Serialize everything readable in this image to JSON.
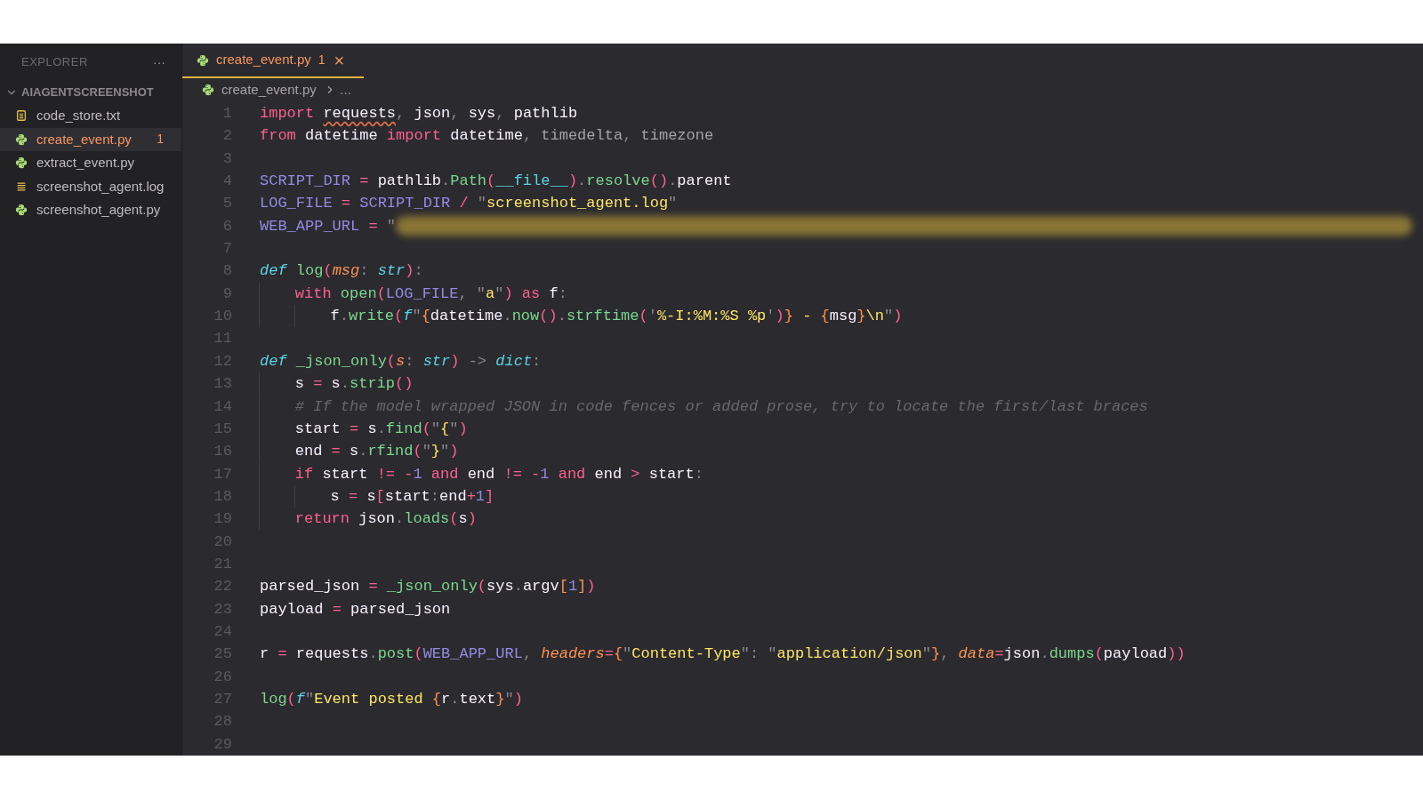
{
  "sidebar": {
    "title": "EXPLORER",
    "more": "···",
    "folder": {
      "name": "AIAGENTSCREENSHOT",
      "expanded": true
    },
    "files": [
      {
        "name": "code_store.txt",
        "kind": "text",
        "selected": false
      },
      {
        "name": "create_event.py",
        "kind": "python",
        "selected": true,
        "problems": "1"
      },
      {
        "name": "extract_event.py",
        "kind": "python",
        "selected": false
      },
      {
        "name": "screenshot_agent.log",
        "kind": "log",
        "selected": false
      },
      {
        "name": "screenshot_agent.py",
        "kind": "python",
        "selected": false
      }
    ]
  },
  "tab": {
    "name": "create_event.py",
    "kind": "python",
    "problems": "1",
    "close": "×",
    "selected": true
  },
  "breadcrumb": {
    "file": "create_event.py",
    "kind": "python",
    "rest": "…"
  },
  "lines": [
    {
      "number": "1",
      "tokens": [
        {
          "kind": "kw",
          "text": "import "
        },
        {
          "kind": "plain",
          "text": "requests",
          "warning": true
        },
        {
          "kind": "punct",
          "text": ", "
        },
        {
          "kind": "plain",
          "text": "json"
        },
        {
          "kind": "punct",
          "text": ", "
        },
        {
          "kind": "plain",
          "text": "sys"
        },
        {
          "kind": "punct",
          "text": ", "
        },
        {
          "kind": "plain",
          "text": "pathlib"
        }
      ]
    },
    {
      "number": "2",
      "tokens": [
        {
          "kind": "kw",
          "text": "from "
        },
        {
          "kind": "plain",
          "text": "datetime "
        },
        {
          "kind": "kw",
          "text": "import "
        },
        {
          "kind": "plain",
          "text": "datetime"
        },
        {
          "kind": "punct",
          "text": ", "
        },
        {
          "kind": "dim",
          "text": "timedelta"
        },
        {
          "kind": "punct",
          "text": ", "
        },
        {
          "kind": "dim",
          "text": "timezone"
        }
      ]
    },
    {
      "number": "3"
    },
    {
      "number": "4",
      "tokens": [
        {
          "kind": "var",
          "text": "SCRIPT_DIR "
        },
        {
          "kind": "op",
          "text": "= "
        },
        {
          "kind": "plain",
          "text": "pathlib"
        },
        {
          "kind": "punct",
          "text": "."
        },
        {
          "kind": "fn",
          "text": "Path"
        },
        {
          "kind": "paren",
          "text": "("
        },
        {
          "kind": "builtin",
          "text": "__file__"
        },
        {
          "kind": "paren",
          "text": ")"
        },
        {
          "kind": "punct",
          "text": "."
        },
        {
          "kind": "fn",
          "text": "resolve"
        },
        {
          "kind": "paren",
          "text": "()"
        },
        {
          "kind": "punct",
          "text": "."
        },
        {
          "kind": "plain",
          "text": "parent"
        }
      ]
    },
    {
      "number": "5",
      "tokens": [
        {
          "kind": "var",
          "text": "LOG_FILE "
        },
        {
          "kind": "op",
          "text": "= "
        },
        {
          "kind": "var",
          "text": "SCRIPT_DIR "
        },
        {
          "kind": "op",
          "text": "/ "
        },
        {
          "kind": "punct",
          "text": "\""
        },
        {
          "kind": "str",
          "text": "screenshot_agent.log"
        },
        {
          "kind": "punct",
          "text": "\""
        }
      ]
    },
    {
      "number": "6",
      "redacted": true,
      "tokens": [
        {
          "kind": "var",
          "text": "WEB_APP_URL "
        },
        {
          "kind": "op",
          "text": "= "
        },
        {
          "kind": "punct",
          "text": "\""
        }
      ]
    },
    {
      "number": "7"
    },
    {
      "number": "8",
      "tokens": [
        {
          "kind": "storage",
          "text": "def "
        },
        {
          "kind": "fn",
          "text": "log"
        },
        {
          "kind": "paren",
          "text": "("
        },
        {
          "kind": "param",
          "text": "msg"
        },
        {
          "kind": "punct",
          "text": ": "
        },
        {
          "kind": "type",
          "text": "str"
        },
        {
          "kind": "paren",
          "text": ")"
        },
        {
          "kind": "punct",
          "text": ":"
        }
      ]
    },
    {
      "number": "9",
      "tokens": [
        {
          "kind": "indent"
        },
        {
          "kind": "kw",
          "text": "with "
        },
        {
          "kind": "fn",
          "text": "open"
        },
        {
          "kind": "paren",
          "text": "("
        },
        {
          "kind": "var",
          "text": "LOG_FILE"
        },
        {
          "kind": "punct",
          "text": ", \""
        },
        {
          "kind": "str",
          "text": "a"
        },
        {
          "kind": "punct",
          "text": "\""
        },
        {
          "kind": "paren",
          "text": ")"
        },
        {
          "kind": "kw",
          "text": " as "
        },
        {
          "kind": "plain",
          "text": "f"
        },
        {
          "kind": "punct",
          "text": ":"
        }
      ]
    },
    {
      "number": "10",
      "tokens": [
        {
          "kind": "indent"
        },
        {
          "kind": "indent"
        },
        {
          "kind": "plain",
          "text": "f"
        },
        {
          "kind": "punct",
          "text": "."
        },
        {
          "kind": "fn",
          "text": "write"
        },
        {
          "kind": "paren",
          "text": "("
        },
        {
          "kind": "storage",
          "text": "f"
        },
        {
          "kind": "punct",
          "text": "\""
        },
        {
          "kind": "bracket",
          "text": "{"
        },
        {
          "kind": "plain",
          "text": "datetime"
        },
        {
          "kind": "punct",
          "text": "."
        },
        {
          "kind": "fn",
          "text": "now"
        },
        {
          "kind": "paren",
          "text": "()"
        },
        {
          "kind": "punct",
          "text": "."
        },
        {
          "kind": "fn",
          "text": "strftime"
        },
        {
          "kind": "paren",
          "text": "("
        },
        {
          "kind": "punct",
          "text": "'"
        },
        {
          "kind": "str",
          "text": "%-I:%M:%S %p"
        },
        {
          "kind": "punct",
          "text": "'"
        },
        {
          "kind": "paren",
          "text": ")"
        },
        {
          "kind": "bracket",
          "text": "}"
        },
        {
          "kind": "str",
          "text": " - "
        },
        {
          "kind": "bracket",
          "text": "{"
        },
        {
          "kind": "plain",
          "text": "msg"
        },
        {
          "kind": "bracket",
          "text": "}"
        },
        {
          "kind": "str",
          "text": "\\n"
        },
        {
          "kind": "punct",
          "text": "\""
        },
        {
          "kind": "paren",
          "text": ")"
        }
      ]
    },
    {
      "number": "11"
    },
    {
      "number": "12",
      "tokens": [
        {
          "kind": "storage",
          "text": "def "
        },
        {
          "kind": "fn",
          "text": "_json_only"
        },
        {
          "kind": "paren",
          "text": "("
        },
        {
          "kind": "param",
          "text": "s"
        },
        {
          "kind": "punct",
          "text": ": "
        },
        {
          "kind": "type",
          "text": "str"
        },
        {
          "kind": "paren",
          "text": ")"
        },
        {
          "kind": "punct",
          "text": " -> "
        },
        {
          "kind": "type",
          "text": "dict"
        },
        {
          "kind": "punct",
          "text": ":"
        }
      ]
    },
    {
      "number": "13",
      "tokens": [
        {
          "kind": "indent"
        },
        {
          "kind": "plain",
          "text": "s "
        },
        {
          "kind": "op",
          "text": "= "
        },
        {
          "kind": "plain",
          "text": "s"
        },
        {
          "kind": "punct",
          "text": "."
        },
        {
          "kind": "fn",
          "text": "strip"
        },
        {
          "kind": "paren",
          "text": "()"
        }
      ]
    },
    {
      "number": "14",
      "tokens": [
        {
          "kind": "indent"
        },
        {
          "kind": "comment",
          "text": "# If the model wrapped JSON in code fences or added prose, try to locate the first/last braces"
        }
      ]
    },
    {
      "number": "15",
      "tokens": [
        {
          "kind": "indent"
        },
        {
          "kind": "plain",
          "text": "start "
        },
        {
          "kind": "op",
          "text": "= "
        },
        {
          "kind": "plain",
          "text": "s"
        },
        {
          "kind": "punct",
          "text": "."
        },
        {
          "kind": "fn",
          "text": "find"
        },
        {
          "kind": "paren",
          "text": "("
        },
        {
          "kind": "punct",
          "text": "\""
        },
        {
          "kind": "str",
          "text": "{"
        },
        {
          "kind": "punct",
          "text": "\""
        },
        {
          "kind": "paren",
          "text": ")"
        }
      ]
    },
    {
      "number": "16",
      "tokens": [
        {
          "kind": "indent"
        },
        {
          "kind": "plain",
          "text": "end "
        },
        {
          "kind": "op",
          "text": "= "
        },
        {
          "kind": "plain",
          "text": "s"
        },
        {
          "kind": "punct",
          "text": "."
        },
        {
          "kind": "fn",
          "text": "rfind"
        },
        {
          "kind": "paren",
          "text": "("
        },
        {
          "kind": "punct",
          "text": "\""
        },
        {
          "kind": "str",
          "text": "}"
        },
        {
          "kind": "punct",
          "text": "\""
        },
        {
          "kind": "paren",
          "text": ")"
        }
      ]
    },
    {
      "number": "17",
      "tokens": [
        {
          "kind": "indent"
        },
        {
          "kind": "kw",
          "text": "if "
        },
        {
          "kind": "plain",
          "text": "start "
        },
        {
          "kind": "op",
          "text": "!= -"
        },
        {
          "kind": "num",
          "text": "1 "
        },
        {
          "kind": "kw",
          "text": "and "
        },
        {
          "kind": "plain",
          "text": "end "
        },
        {
          "kind": "op",
          "text": "!= -"
        },
        {
          "kind": "num",
          "text": "1 "
        },
        {
          "kind": "kw",
          "text": "and "
        },
        {
          "kind": "plain",
          "text": "end "
        },
        {
          "kind": "op",
          "text": "> "
        },
        {
          "kind": "plain",
          "text": "start"
        },
        {
          "kind": "punct",
          "text": ":"
        }
      ]
    },
    {
      "number": "18",
      "tokens": [
        {
          "kind": "indent"
        },
        {
          "kind": "indent"
        },
        {
          "kind": "plain",
          "text": "s "
        },
        {
          "kind": "op",
          "text": "= "
        },
        {
          "kind": "plain",
          "text": "s"
        },
        {
          "kind": "paren",
          "text": "["
        },
        {
          "kind": "plain",
          "text": "start"
        },
        {
          "kind": "punct",
          "text": ":"
        },
        {
          "kind": "plain",
          "text": "end"
        },
        {
          "kind": "op",
          "text": "+"
        },
        {
          "kind": "num",
          "text": "1"
        },
        {
          "kind": "paren",
          "text": "]"
        }
      ]
    },
    {
      "number": "19",
      "tokens": [
        {
          "kind": "indent"
        },
        {
          "kind": "kw",
          "text": "return "
        },
        {
          "kind": "plain",
          "text": "json"
        },
        {
          "kind": "punct",
          "text": "."
        },
        {
          "kind": "fn",
          "text": "loads"
        },
        {
          "kind": "paren",
          "text": "("
        },
        {
          "kind": "plain",
          "text": "s"
        },
        {
          "kind": "paren",
          "text": ")"
        }
      ]
    },
    {
      "number": "20"
    },
    {
      "number": "21"
    },
    {
      "number": "22",
      "tokens": [
        {
          "kind": "plain",
          "text": "parsed_json "
        },
        {
          "kind": "op",
          "text": "= "
        },
        {
          "kind": "fn",
          "text": "_json_only"
        },
        {
          "kind": "paren",
          "text": "("
        },
        {
          "kind": "plain",
          "text": "sys"
        },
        {
          "kind": "punct",
          "text": "."
        },
        {
          "kind": "plain",
          "text": "argv"
        },
        {
          "kind": "bracket",
          "text": "["
        },
        {
          "kind": "num",
          "text": "1"
        },
        {
          "kind": "bracket",
          "text": "]"
        },
        {
          "kind": "paren",
          "text": ")"
        }
      ]
    },
    {
      "number": "23",
      "tokens": [
        {
          "kind": "plain",
          "text": "payload "
        },
        {
          "kind": "op",
          "text": "= "
        },
        {
          "kind": "plain",
          "text": "parsed_json"
        }
      ]
    },
    {
      "number": "24"
    },
    {
      "number": "25",
      "tokens": [
        {
          "kind": "plain",
          "text": "r "
        },
        {
          "kind": "op",
          "text": "= "
        },
        {
          "kind": "plain",
          "text": "requests"
        },
        {
          "kind": "punct",
          "text": "."
        },
        {
          "kind": "fn",
          "text": "post"
        },
        {
          "kind": "paren",
          "text": "("
        },
        {
          "kind": "var",
          "text": "WEB_APP_URL"
        },
        {
          "kind": "punct",
          "text": ", "
        },
        {
          "kind": "param",
          "text": "headers"
        },
        {
          "kind": "op",
          "text": "="
        },
        {
          "kind": "bracket",
          "text": "{"
        },
        {
          "kind": "punct",
          "text": "\""
        },
        {
          "kind": "str",
          "text": "Content-Type"
        },
        {
          "kind": "punct",
          "text": "\": \""
        },
        {
          "kind": "str",
          "text": "application/json"
        },
        {
          "kind": "punct",
          "text": "\""
        },
        {
          "kind": "bracket",
          "text": "}"
        },
        {
          "kind": "punct",
          "text": ", "
        },
        {
          "kind": "param",
          "text": "data"
        },
        {
          "kind": "op",
          "text": "="
        },
        {
          "kind": "plain",
          "text": "json"
        },
        {
          "kind": "punct",
          "text": "."
        },
        {
          "kind": "fn",
          "text": "dumps"
        },
        {
          "kind": "paren",
          "text": "("
        },
        {
          "kind": "plain",
          "text": "payload"
        },
        {
          "kind": "paren",
          "text": "))"
        }
      ]
    },
    {
      "number": "26"
    },
    {
      "number": "27",
      "tokens": [
        {
          "kind": "fn",
          "text": "log"
        },
        {
          "kind": "paren",
          "text": "("
        },
        {
          "kind": "storage",
          "text": "f"
        },
        {
          "kind": "punct",
          "text": "\""
        },
        {
          "kind": "str",
          "text": "Event posted "
        },
        {
          "kind": "bracket",
          "text": "{"
        },
        {
          "kind": "plain",
          "text": "r"
        },
        {
          "kind": "punct",
          "text": "."
        },
        {
          "kind": "plain",
          "text": "text"
        },
        {
          "kind": "bracket",
          "text": "}"
        },
        {
          "kind": "punct",
          "text": "\""
        },
        {
          "kind": "paren",
          "text": ")"
        }
      ]
    },
    {
      "number": "28"
    },
    {
      "number": "29"
    }
  ]
}
